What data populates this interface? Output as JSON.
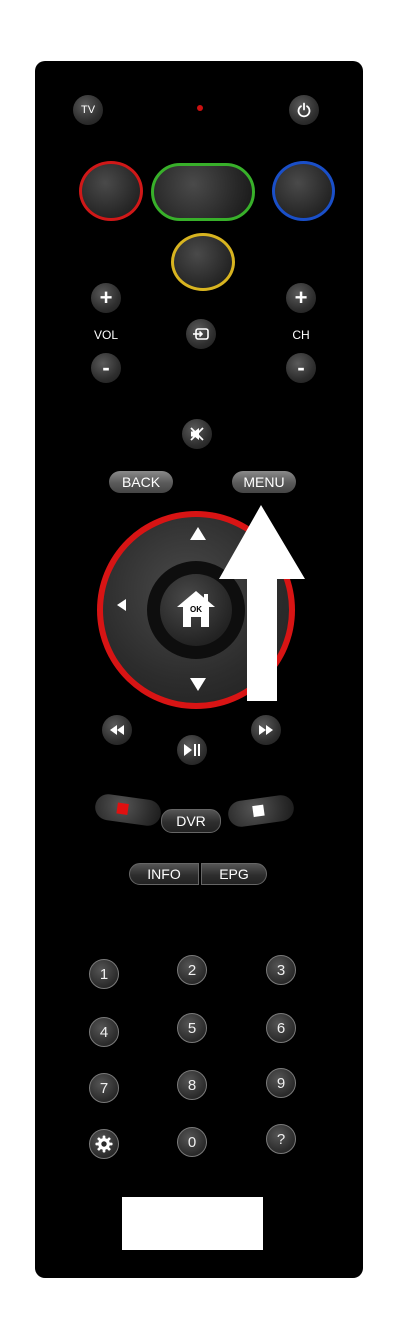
{
  "buttons": {
    "tv": "TV",
    "vol": "VOL",
    "ch": "CH",
    "plus": "+",
    "minus": "-",
    "back": "BACK",
    "menu": "MENU",
    "ok": "OK",
    "dvr": "DVR",
    "info": "INFO",
    "epg": "EPG"
  },
  "numpad": {
    "row1": [
      "1",
      "2",
      "3"
    ],
    "row2": [
      "4",
      "5",
      "6"
    ],
    "row3": [
      "7",
      "8",
      "9"
    ],
    "row4_center": "0",
    "row4_right": "?"
  },
  "colors": {
    "red": "#d01818",
    "green": "#38b02a",
    "blue": "#1a4fc8",
    "yellow": "#d8b420",
    "dpad_ring": "#d81414",
    "led": "#cc1010"
  }
}
